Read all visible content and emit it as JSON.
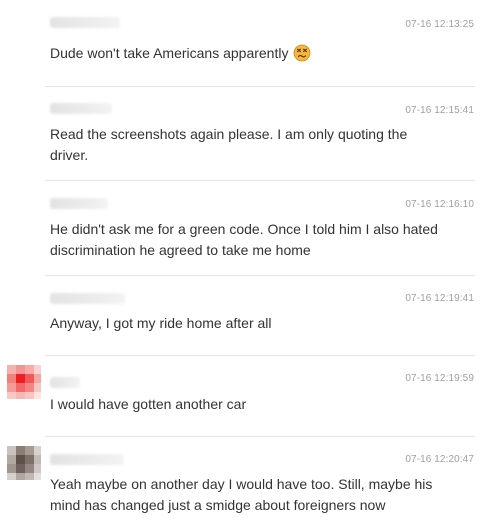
{
  "comments": [
    {
      "time": "07-16 12:13:25",
      "text": "Dude won't take Americans apparently",
      "emoji": "dizzy-face-emoji"
    },
    {
      "time": "07-16 12:15:41",
      "text": "Read the screenshots again please. I am only quoting the driver."
    },
    {
      "time": "07-16 12:16:10",
      "text": "He didn't ask me for a green code. Once I told him I also hated discrimination he agreed to take me home"
    },
    {
      "time": "07-16 12:19:41",
      "text": "Anyway, I got my ride home after all"
    },
    {
      "time": "07-16 12:19:59",
      "text": "I would have gotten another car"
    },
    {
      "time": "07-16 12:20:47",
      "text": "Yeah maybe on another day I would have too. Still, maybe his mind has changed just a smidge about foreigners now"
    }
  ],
  "colors": {
    "text": "#333333",
    "timestamp": "#a0a0a0",
    "divider": "#e6e6e6",
    "emoji_face": "#f6b73c"
  }
}
